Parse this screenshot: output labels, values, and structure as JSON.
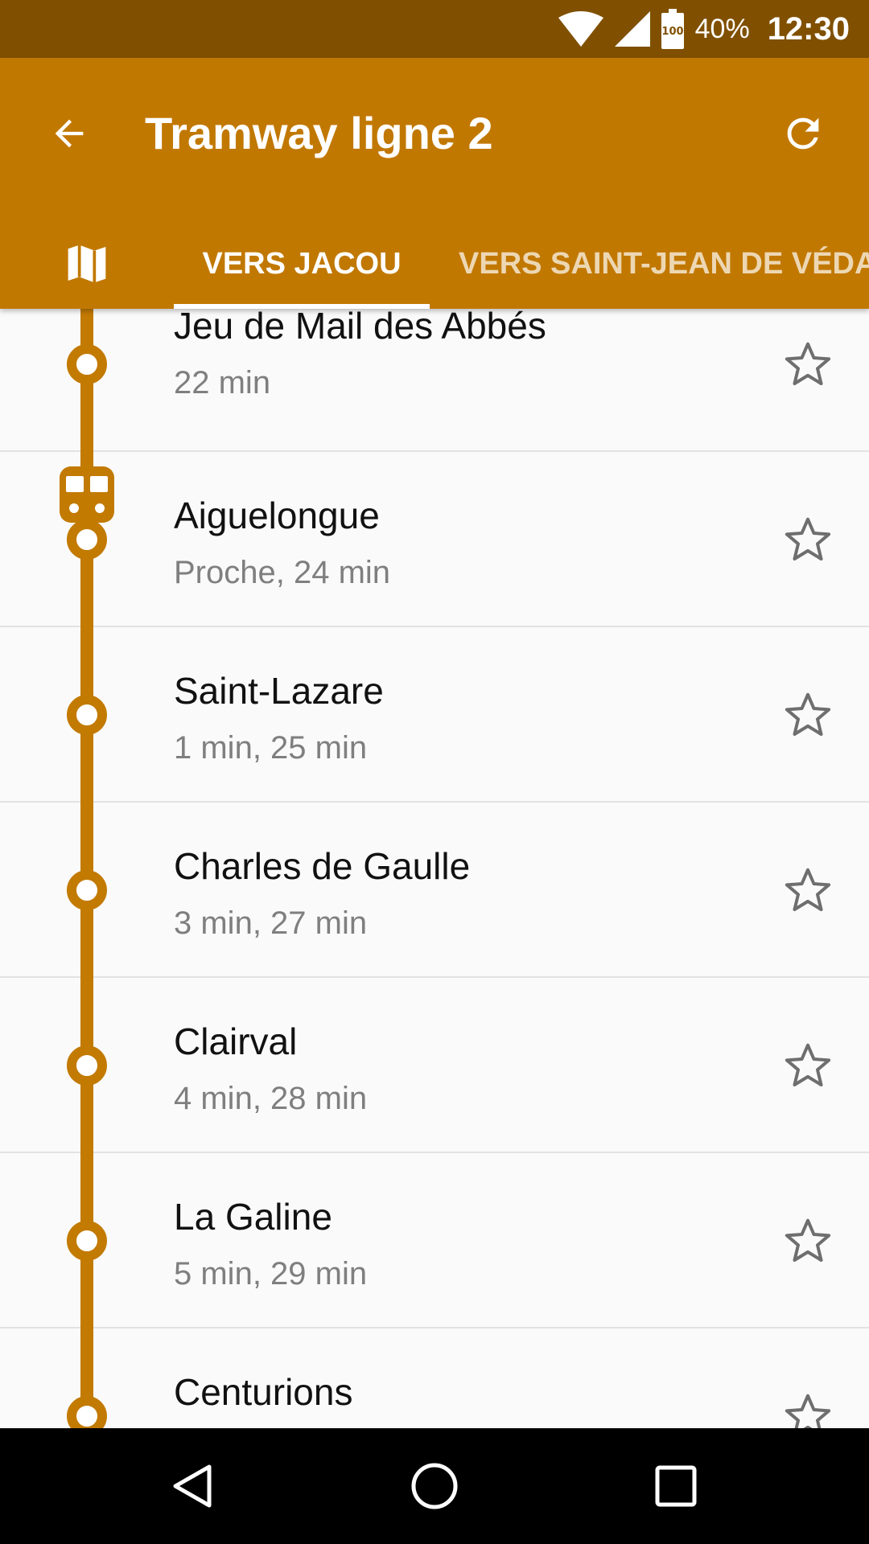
{
  "status_bar": {
    "battery_label": "100",
    "battery_percent": "40%",
    "time": "12:30"
  },
  "app_bar": {
    "title": "Tramway ligne 2",
    "back_icon": "arrow-back-icon",
    "refresh_icon": "refresh-icon",
    "background_color": "#c17800"
  },
  "tabs": {
    "map_icon": "map-icon",
    "items": [
      {
        "label": "VERS JACOU",
        "selected": true
      },
      {
        "label": "VERS SAINT-JEAN DE VÉDA",
        "selected": false
      }
    ]
  },
  "stops": [
    {
      "name": "Jeu de Mail des Abbés",
      "times": "22 min",
      "favorite": false
    },
    {
      "name": "Aiguelongue",
      "times": "Proche, 24 min",
      "favorite": false,
      "tram_here": true
    },
    {
      "name": "Saint-Lazare",
      "times": "1 min, 25 min",
      "favorite": false
    },
    {
      "name": "Charles de Gaulle",
      "times": "3 min, 27 min",
      "favorite": false
    },
    {
      "name": "Clairval",
      "times": "4 min, 28 min",
      "favorite": false
    },
    {
      "name": "La Galine",
      "times": "5 min, 29 min",
      "favorite": false
    },
    {
      "name": "Centurions",
      "times": "",
      "favorite": false
    }
  ],
  "line_color": "#c27a00",
  "nav_bar": {
    "back_icon": "nav-back-icon",
    "home_icon": "nav-home-icon",
    "recents_icon": "nav-recents-icon"
  }
}
